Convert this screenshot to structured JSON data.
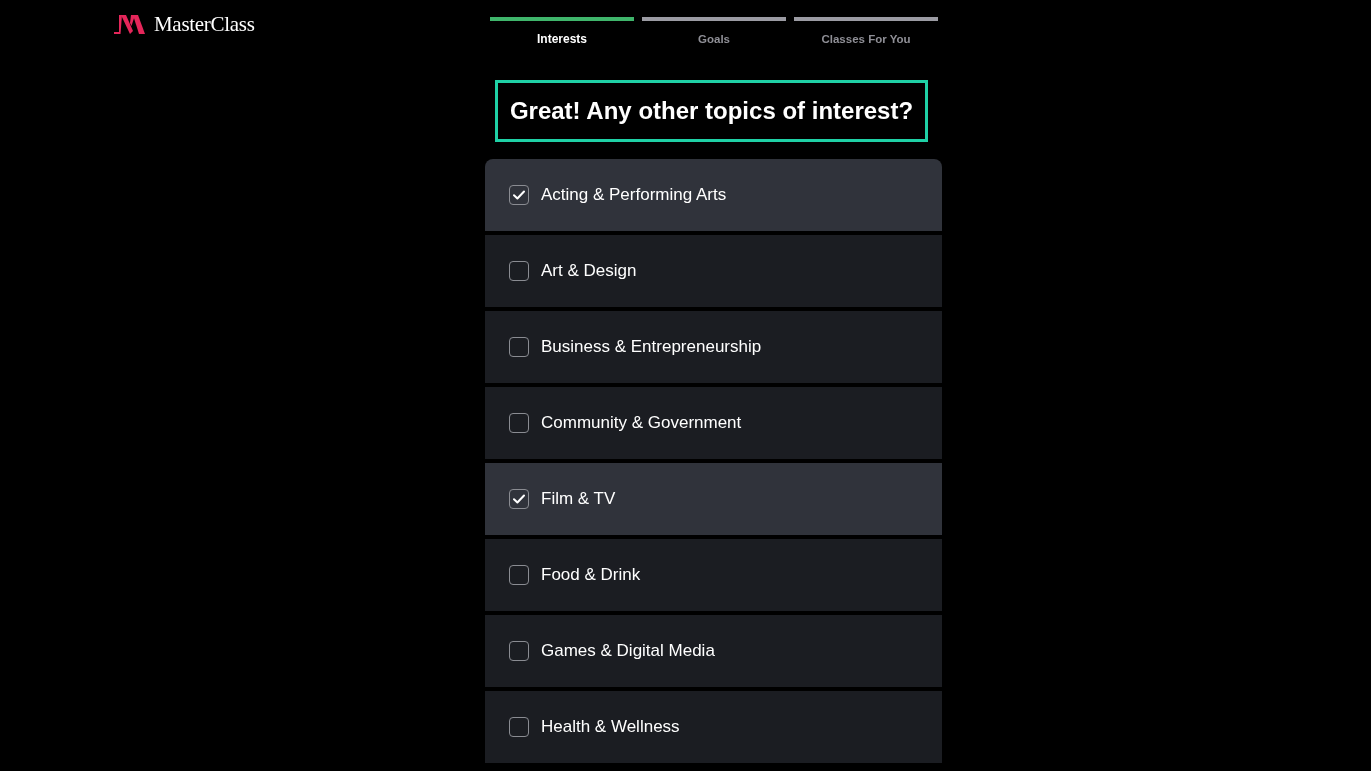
{
  "header": {
    "brand": "MasterClass"
  },
  "steps": [
    {
      "label": "Interests",
      "selected": true
    },
    {
      "label": "Goals",
      "selected": false
    },
    {
      "label": "Classes For You",
      "selected": false
    }
  ],
  "heading": "Great! Any other topics of interest?",
  "topics": [
    {
      "label": "Acting & Performing Arts",
      "checked": true
    },
    {
      "label": "Art & Design",
      "checked": false
    },
    {
      "label": "Business & Entrepreneurship",
      "checked": false
    },
    {
      "label": "Community & Government",
      "checked": false
    },
    {
      "label": "Film & TV",
      "checked": true
    },
    {
      "label": "Food & Drink",
      "checked": false
    },
    {
      "label": "Games & Digital Media",
      "checked": false
    },
    {
      "label": "Health & Wellness",
      "checked": false
    }
  ]
}
